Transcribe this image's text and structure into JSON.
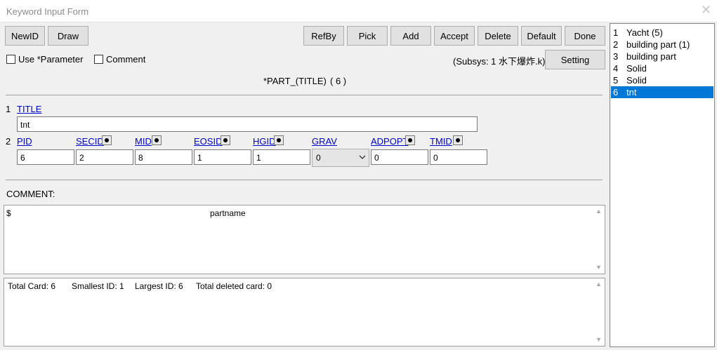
{
  "window": {
    "title": "Keyword Input Form"
  },
  "toolbar": {
    "newid": "NewID",
    "draw": "Draw",
    "refby": "RefBy",
    "pick": "Pick",
    "add": "Add",
    "accept": "Accept",
    "delete": "Delete",
    "default": "Default",
    "done": "Done",
    "setting": "Setting"
  },
  "options": {
    "use_parameter": "Use *Parameter",
    "comment": "Comment"
  },
  "subsys": "(Subsys: 1 水下爆炸.k)",
  "keyword": {
    "name": "*PART_(TITLE)",
    "count": "( 6 )"
  },
  "card1": {
    "row": "1",
    "title_label": "TITLE",
    "title_value": "tnt"
  },
  "card2": {
    "row": "2",
    "labels": {
      "pid": "PID",
      "secid": "SECID",
      "mid": "MID",
      "eosid": "EOSID",
      "hgid": "HGID",
      "grav": "GRAV",
      "adpopt": "ADPOPT",
      "tmid": "TMID"
    },
    "values": {
      "pid": "6",
      "secid": "2",
      "mid": "8",
      "eosid": "1",
      "hgid": "1",
      "grav": "0",
      "adpopt": "0",
      "tmid": "0"
    }
  },
  "comment": {
    "label": "COMMENT:",
    "line_prefix": "$",
    "line_text": "partname"
  },
  "summary": {
    "total_card": "Total Card: 6",
    "smallest_id": "Smallest ID: 1",
    "largest_id": "Largest ID: 6",
    "total_deleted": "Total deleted card:  0"
  },
  "list": [
    {
      "num": "1",
      "name": "Yacht (5)"
    },
    {
      "num": "2",
      "name": "building part (1)"
    },
    {
      "num": "3",
      "name": "building part"
    },
    {
      "num": "4",
      "name": "Solid"
    },
    {
      "num": "5",
      "name": "Solid"
    },
    {
      "num": "6",
      "name": "tnt"
    }
  ],
  "selected_index": 5,
  "colors": {
    "selection": "#0078d7",
    "link": "#0000cc",
    "button_face": "#e1e1e1"
  },
  "icons": {
    "close": "close-icon",
    "select_arrow": "chevron-down-icon",
    "scroll_up": "scroll-up-arrow-icon",
    "scroll_down": "scroll-down-arrow-icon"
  }
}
